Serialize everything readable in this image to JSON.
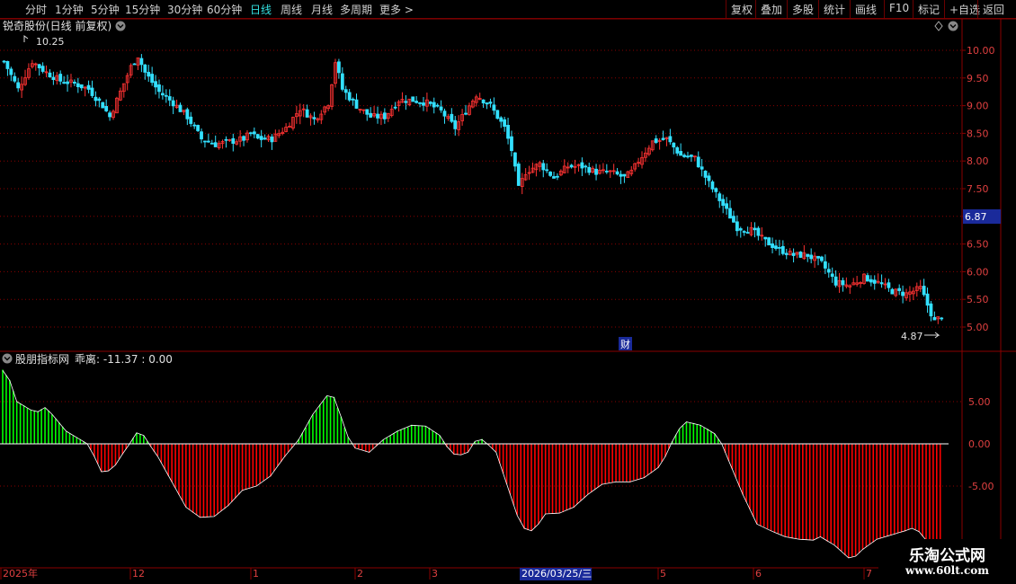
{
  "toolbar": {
    "periods": [
      "分时",
      "1分钟",
      "5分钟",
      "15分钟",
      "30分钟",
      "60分钟",
      "日线",
      "周线",
      "月线",
      "多周期",
      "更多 >"
    ],
    "active": "日线",
    "right_buttons": [
      "复权",
      "叠加",
      "多股",
      "统计",
      "画线",
      "F10",
      "标记",
      "+自选",
      "返回"
    ]
  },
  "main_chart": {
    "title": "锐奇股份(日线 前复权)",
    "high_label": "10.25",
    "low_label": "4.87",
    "current_price": "6.87",
    "fin_marker": "财",
    "y_ticks": [
      "10.00",
      "9.50",
      "9.00",
      "8.50",
      "8.00",
      "7.50",
      "7.00",
      "6.50",
      "6.00",
      "5.50",
      "5.00"
    ]
  },
  "indicator": {
    "title": "股朋指标网",
    "label": "乖离: -11.37 : 0.00",
    "y_ticks": [
      "5.00",
      "0.00",
      "-5.00"
    ]
  },
  "date_axis": {
    "labels": [
      "2025年",
      "12",
      "1",
      "2",
      "3",
      "5",
      "6",
      "7"
    ],
    "highlight": "2026/03/25/三"
  },
  "watermark": {
    "line1": "乐淘公式网",
    "line2": "www.60lt.com"
  },
  "colors": {
    "up": "#ff3333",
    "down": "#33e0ff",
    "grid": "#8a0000",
    "pos_bar": "#00ff00",
    "neg_bar": "#ff0000",
    "highlight_bg": "#1a2a9a"
  },
  "chart_data": [
    {
      "type": "candlestick",
      "title": "锐奇股份(日线 前复权)",
      "ylim": [
        4.7,
        10.6
      ],
      "close_path": [
        [
          0,
          9.8
        ],
        [
          4,
          9.3
        ],
        [
          8,
          9.8
        ],
        [
          12,
          9.6
        ],
        [
          16,
          9.45
        ],
        [
          20,
          9.4
        ],
        [
          24,
          9.3
        ],
        [
          28,
          9.0
        ],
        [
          30,
          8.8
        ],
        [
          32,
          9.1
        ],
        [
          36,
          9.7
        ],
        [
          38,
          9.9
        ],
        [
          40,
          9.6
        ],
        [
          44,
          9.25
        ],
        [
          48,
          9.05
        ],
        [
          52,
          8.8
        ],
        [
          56,
          8.4
        ],
        [
          60,
          8.3
        ],
        [
          64,
          8.35
        ],
        [
          68,
          8.4
        ],
        [
          70,
          8.5
        ],
        [
          72,
          8.4
        ],
        [
          76,
          8.4
        ],
        [
          80,
          8.6
        ],
        [
          84,
          8.95
        ],
        [
          88,
          8.75
        ],
        [
          92,
          9.05
        ],
        [
          94,
          9.8
        ],
        [
          96,
          9.3
        ],
        [
          100,
          9.0
        ],
        [
          104,
          8.8
        ],
        [
          108,
          8.8
        ],
        [
          112,
          9.1
        ],
        [
          116,
          9.1
        ],
        [
          120,
          9.05
        ],
        [
          124,
          8.9
        ],
        [
          128,
          8.6
        ],
        [
          132,
          9.0
        ],
        [
          134,
          9.2
        ],
        [
          138,
          9.0
        ],
        [
          142,
          8.6
        ],
        [
          144,
          8.2
        ],
        [
          146,
          7.5
        ],
        [
          148,
          7.8
        ],
        [
          152,
          7.95
        ],
        [
          156,
          7.7
        ],
        [
          160,
          7.9
        ],
        [
          164,
          7.9
        ],
        [
          168,
          7.8
        ],
        [
          172,
          7.8
        ],
        [
          176,
          7.7
        ],
        [
          178,
          7.8
        ],
        [
          180,
          8.0
        ],
        [
          184,
          8.35
        ],
        [
          188,
          8.4
        ],
        [
          192,
          8.1
        ],
        [
          196,
          8.05
        ],
        [
          200,
          7.6
        ],
        [
          204,
          7.2
        ],
        [
          208,
          6.8
        ],
        [
          212,
          6.75
        ],
        [
          216,
          6.55
        ],
        [
          220,
          6.4
        ],
        [
          224,
          6.3
        ],
        [
          228,
          6.3
        ],
        [
          232,
          6.15
        ],
        [
          236,
          5.8
        ],
        [
          240,
          5.75
        ],
        [
          244,
          5.9
        ],
        [
          248,
          5.8
        ],
        [
          252,
          5.65
        ],
        [
          256,
          5.6
        ],
        [
          260,
          5.7
        ],
        [
          264,
          5.1
        ],
        [
          266,
          5.2
        ]
      ],
      "high": 10.25,
      "low": 4.87,
      "last": 6.87
    },
    {
      "type": "bar",
      "title": "乖离",
      "value_label": "-11.37",
      "ylim": [
        -14,
        9.5
      ],
      "path": [
        [
          0,
          8.7
        ],
        [
          2,
          7.5
        ],
        [
          4,
          5.0
        ],
        [
          8,
          4.0
        ],
        [
          10,
          3.8
        ],
        [
          12,
          4.3
        ],
        [
          14,
          3.5
        ],
        [
          18,
          1.5
        ],
        [
          22,
          0.5
        ],
        [
          24,
          0
        ],
        [
          26,
          -1.5
        ],
        [
          28,
          -3.3
        ],
        [
          30,
          -3.2
        ],
        [
          32,
          -2.5
        ],
        [
          34,
          -1.2
        ],
        [
          36,
          0
        ],
        [
          38,
          1.3
        ],
        [
          40,
          1.0
        ],
        [
          42,
          -0.3
        ],
        [
          44,
          -1.5
        ],
        [
          48,
          -4.5
        ],
        [
          52,
          -7.5
        ],
        [
          56,
          -8.7
        ],
        [
          60,
          -8.6
        ],
        [
          64,
          -7.3
        ],
        [
          68,
          -5.5
        ],
        [
          72,
          -5.0
        ],
        [
          76,
          -3.8
        ],
        [
          80,
          -1.5
        ],
        [
          84,
          0.5
        ],
        [
          88,
          3.5
        ],
        [
          92,
          5.7
        ],
        [
          94,
          5.5
        ],
        [
          96,
          3.2
        ],
        [
          98,
          0.8
        ],
        [
          100,
          -0.5
        ],
        [
          104,
          -1.0
        ],
        [
          108,
          0.5
        ],
        [
          112,
          1.5
        ],
        [
          116,
          2.2
        ],
        [
          120,
          2.1
        ],
        [
          124,
          1.0
        ],
        [
          126,
          -0.3
        ],
        [
          128,
          -1.2
        ],
        [
          130,
          -1.3
        ],
        [
          132,
          -1.0
        ],
        [
          134,
          0.3
        ],
        [
          136,
          0.5
        ],
        [
          138,
          -0.2
        ],
        [
          140,
          -1.0
        ],
        [
          142,
          -3.5
        ],
        [
          144,
          -6.0
        ],
        [
          146,
          -8.5
        ],
        [
          148,
          -10.0
        ],
        [
          150,
          -10.3
        ],
        [
          152,
          -9.5
        ],
        [
          154,
          -8.3
        ],
        [
          158,
          -8.2
        ],
        [
          162,
          -7.5
        ],
        [
          166,
          -6.0
        ],
        [
          170,
          -4.8
        ],
        [
          174,
          -4.5
        ],
        [
          178,
          -4.5
        ],
        [
          182,
          -4.0
        ],
        [
          186,
          -2.8
        ],
        [
          188,
          -1.5
        ],
        [
          190,
          0.3
        ],
        [
          192,
          1.8
        ],
        [
          194,
          2.6
        ],
        [
          198,
          2.2
        ],
        [
          202,
          1.2
        ],
        [
          204,
          0
        ],
        [
          206,
          -2.0
        ],
        [
          210,
          -6.0
        ],
        [
          214,
          -9.5
        ],
        [
          218,
          -10.3
        ],
        [
          222,
          -11.0
        ],
        [
          226,
          -11.3
        ],
        [
          230,
          -11.4
        ],
        [
          232,
          -11.0
        ],
        [
          236,
          -12.0
        ],
        [
          240,
          -13.5
        ],
        [
          242,
          -13.3
        ],
        [
          244,
          -12.5
        ],
        [
          248,
          -11.3
        ],
        [
          252,
          -10.8
        ],
        [
          256,
          -10.3
        ],
        [
          258,
          -10.0
        ],
        [
          260,
          -10.4
        ],
        [
          262,
          -11.4
        ]
      ],
      "zero_line": 0.0
    }
  ]
}
